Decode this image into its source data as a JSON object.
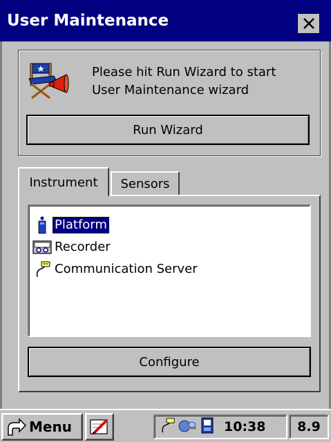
{
  "window": {
    "title": "User Maintenance",
    "close_label": "✕"
  },
  "wizard": {
    "message_line1": "Please hit Run Wizard to start",
    "message_line2": "User Maintenance wizard",
    "run_button": "Run Wizard",
    "icon": "directors-chair-icon"
  },
  "tabs": [
    {
      "label": "Instrument",
      "active": true
    },
    {
      "label": "Sensors",
      "active": false
    }
  ],
  "instrument_list": [
    {
      "label": "Platform",
      "icon": "platform-icon",
      "selected": true
    },
    {
      "label": "Recorder",
      "icon": "recorder-icon",
      "selected": false
    },
    {
      "label": "Communication Server",
      "icon": "connector-icon",
      "selected": false
    }
  ],
  "configure_button": "Configure",
  "taskbar": {
    "start_label": "Menu",
    "clock": "10:38",
    "version": "8.9",
    "tray_icons": [
      "connector-icon",
      "network-icon",
      "storage-card-icon"
    ]
  },
  "colors": {
    "titlebar": "#000080",
    "selection": "#000080",
    "window": "#c0c0c0"
  }
}
